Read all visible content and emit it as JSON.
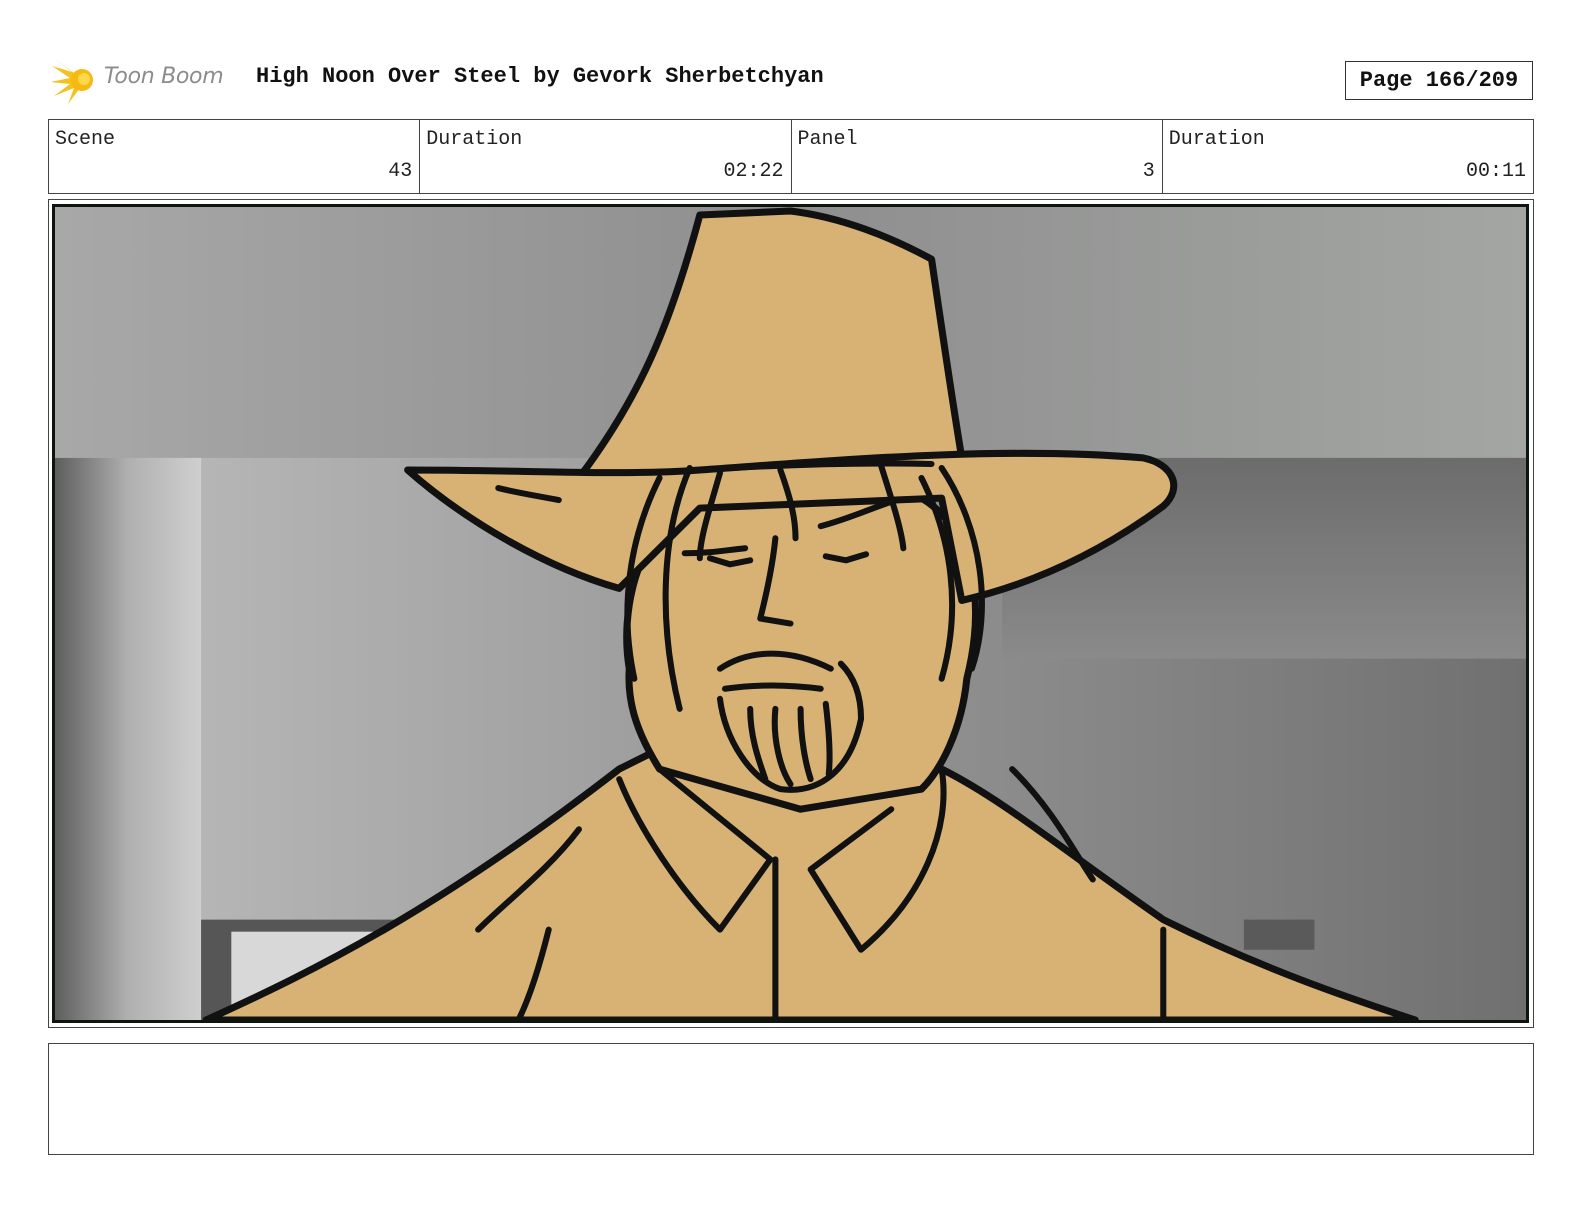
{
  "header": {
    "logo_text": "Toon Boom",
    "title": "High Noon Over Steel by Gevork Sherbetchyan",
    "page": "Page 166/209"
  },
  "info": [
    {
      "label": "Scene",
      "value": "43"
    },
    {
      "label": "Duration",
      "value": "02:22"
    },
    {
      "label": "Panel",
      "value": "3"
    },
    {
      "label": "Duration",
      "value": "00:11"
    }
  ],
  "panel": {
    "skin_color": "#d7b274",
    "line_color": "#111111",
    "frame_color": "#1b3a1b"
  },
  "notes": {
    "text": ""
  }
}
